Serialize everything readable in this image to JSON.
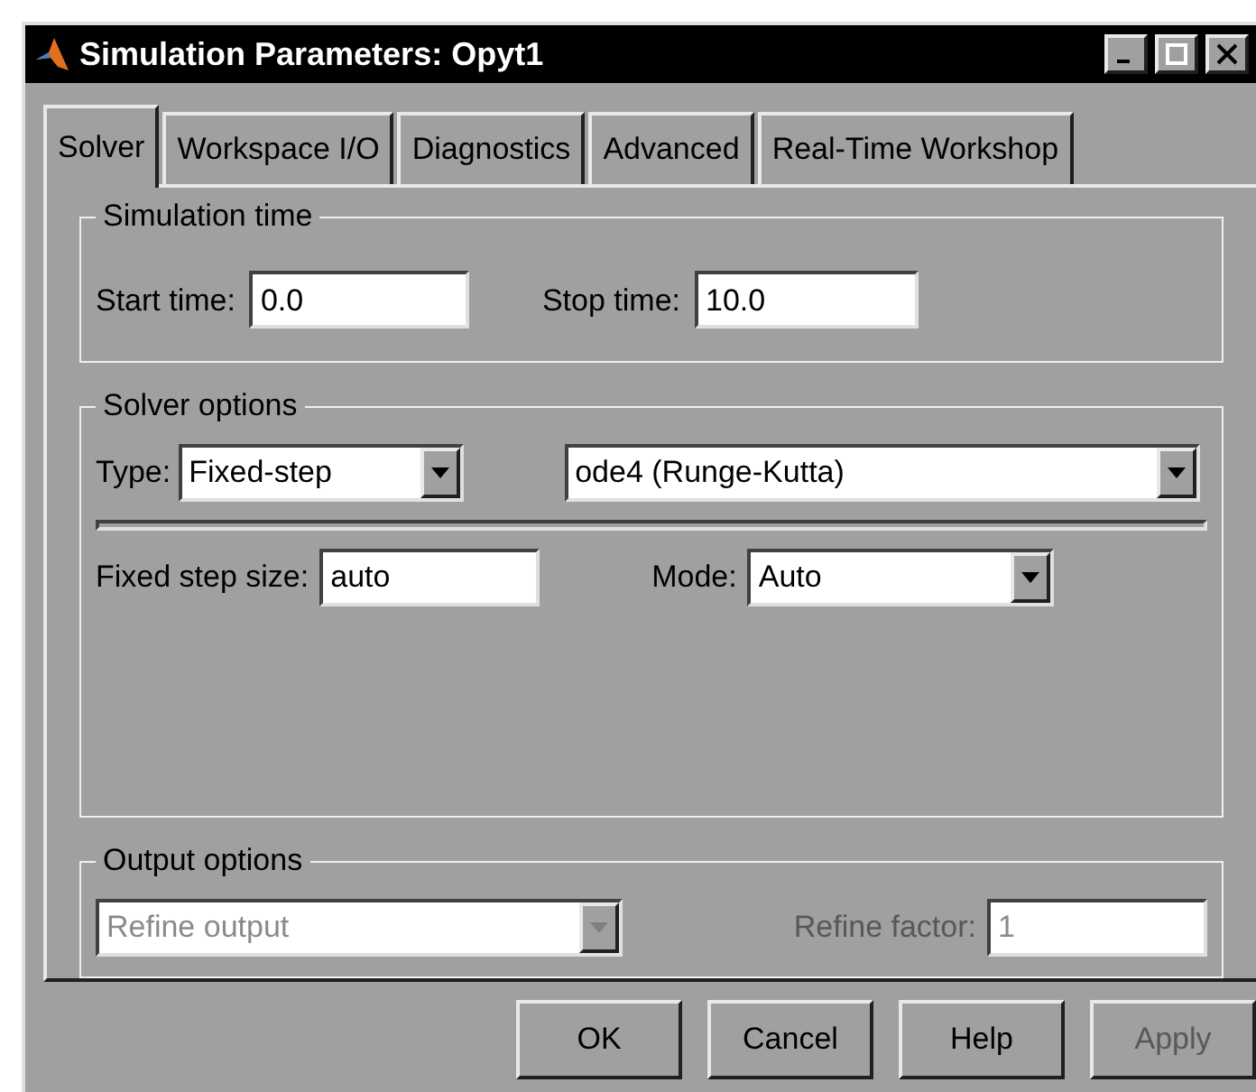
{
  "window": {
    "title": "Simulation Parameters: Opyt1"
  },
  "tabs": [
    {
      "label": "Solver",
      "selected": true
    },
    {
      "label": "Workspace I/O",
      "selected": false
    },
    {
      "label": "Diagnostics",
      "selected": false
    },
    {
      "label": "Advanced",
      "selected": false
    },
    {
      "label": "Real-Time Workshop",
      "selected": false
    }
  ],
  "simulation_time": {
    "title": "Simulation time",
    "start_label": "Start time:",
    "start_value": "0.0",
    "stop_label": "Stop time:",
    "stop_value": "10.0"
  },
  "solver_options": {
    "title": "Solver options",
    "type_label": "Type:",
    "type_value": "Fixed-step",
    "solver_value": "ode4 (Runge-Kutta)",
    "step_label": "Fixed step size:",
    "step_value": "auto",
    "mode_label": "Mode:",
    "mode_value": "Auto"
  },
  "output_options": {
    "title": "Output options",
    "disabled": true,
    "select_value": "Refine output",
    "factor_label": "Refine factor:",
    "factor_value": "1"
  },
  "buttons": [
    {
      "label": "OK",
      "disabled": false
    },
    {
      "label": "Cancel",
      "disabled": false
    },
    {
      "label": "Help",
      "disabled": false
    },
    {
      "label": "Apply",
      "disabled": true
    }
  ]
}
